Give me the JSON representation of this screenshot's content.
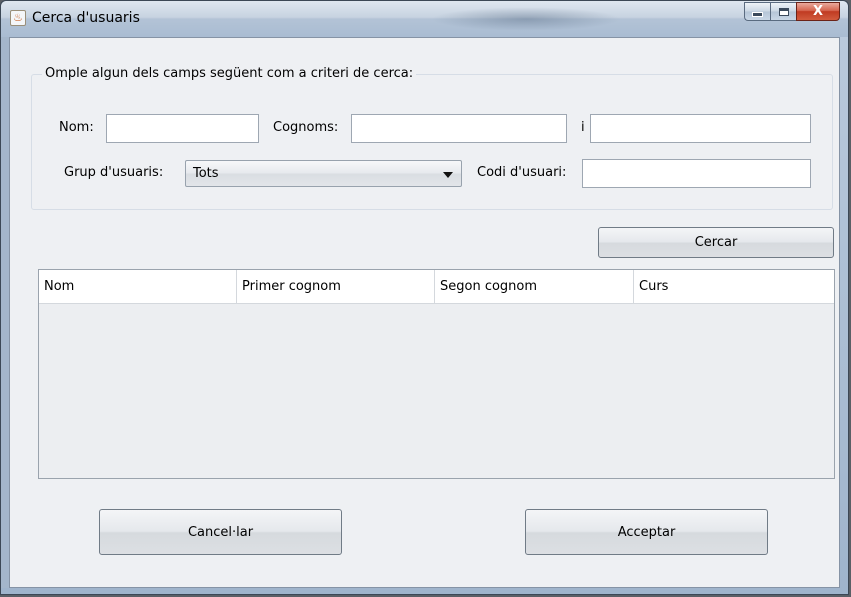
{
  "window": {
    "title": "Cerca d'usuaris",
    "icon": "java-cup-icon",
    "controls": {
      "minimize": "minimize-icon",
      "maximize": "maximize-icon",
      "close": "X"
    }
  },
  "criteria": {
    "legend": "Omple algun dels camps següent com a criteri de cerca:",
    "nom_label": "Nom:",
    "nom_value": "",
    "cognoms_label": "Cognoms:",
    "cognom1_value": "",
    "separator": "i",
    "cognom2_value": "",
    "grup_label": "Grup d'usuaris:",
    "grup_selected": "Tots",
    "codi_label": "Codi d'usuari:",
    "codi_value": ""
  },
  "search_button": "Cercar",
  "table": {
    "columns": [
      "Nom",
      "Primer cognom",
      "Segon cognom",
      "Curs"
    ],
    "rows": []
  },
  "footer": {
    "cancel": "Cancel·lar",
    "accept": "Acceptar"
  }
}
